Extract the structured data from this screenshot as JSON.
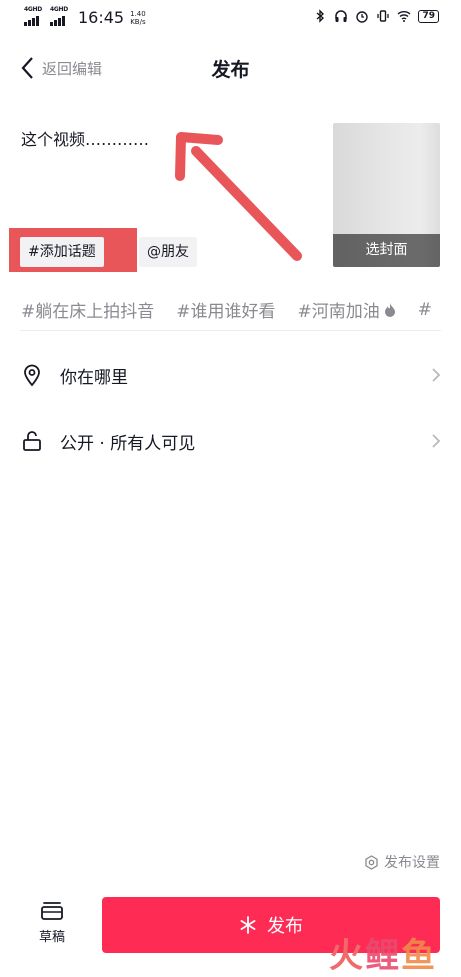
{
  "status_bar": {
    "net1": "4GHD",
    "net2": "4GHD",
    "time": "16:45",
    "speed_value": "1.40",
    "speed_unit": "KB/s",
    "battery": "79"
  },
  "header": {
    "back_label": "返回编辑",
    "title": "发布"
  },
  "caption": "这个视频…………",
  "cover": {
    "label": "选封面"
  },
  "chips": {
    "topic": "#添加话题",
    "friend": "@朋友"
  },
  "topics": [
    "#躺在床上拍抖音",
    "#谁用谁好看",
    "#河南加油",
    "#"
  ],
  "rows": {
    "location": "你在哪里",
    "privacy": "公开 · 所有人可见"
  },
  "settings_label": "发布设置",
  "draft_label": "草稿",
  "publish_label": "发布",
  "watermark": {
    "a": "火",
    "b": "鲤",
    "c": "鱼"
  },
  "colors": {
    "accent": "#fe2c55",
    "annotation": "#e8565a",
    "muted": "#8a8b91"
  }
}
